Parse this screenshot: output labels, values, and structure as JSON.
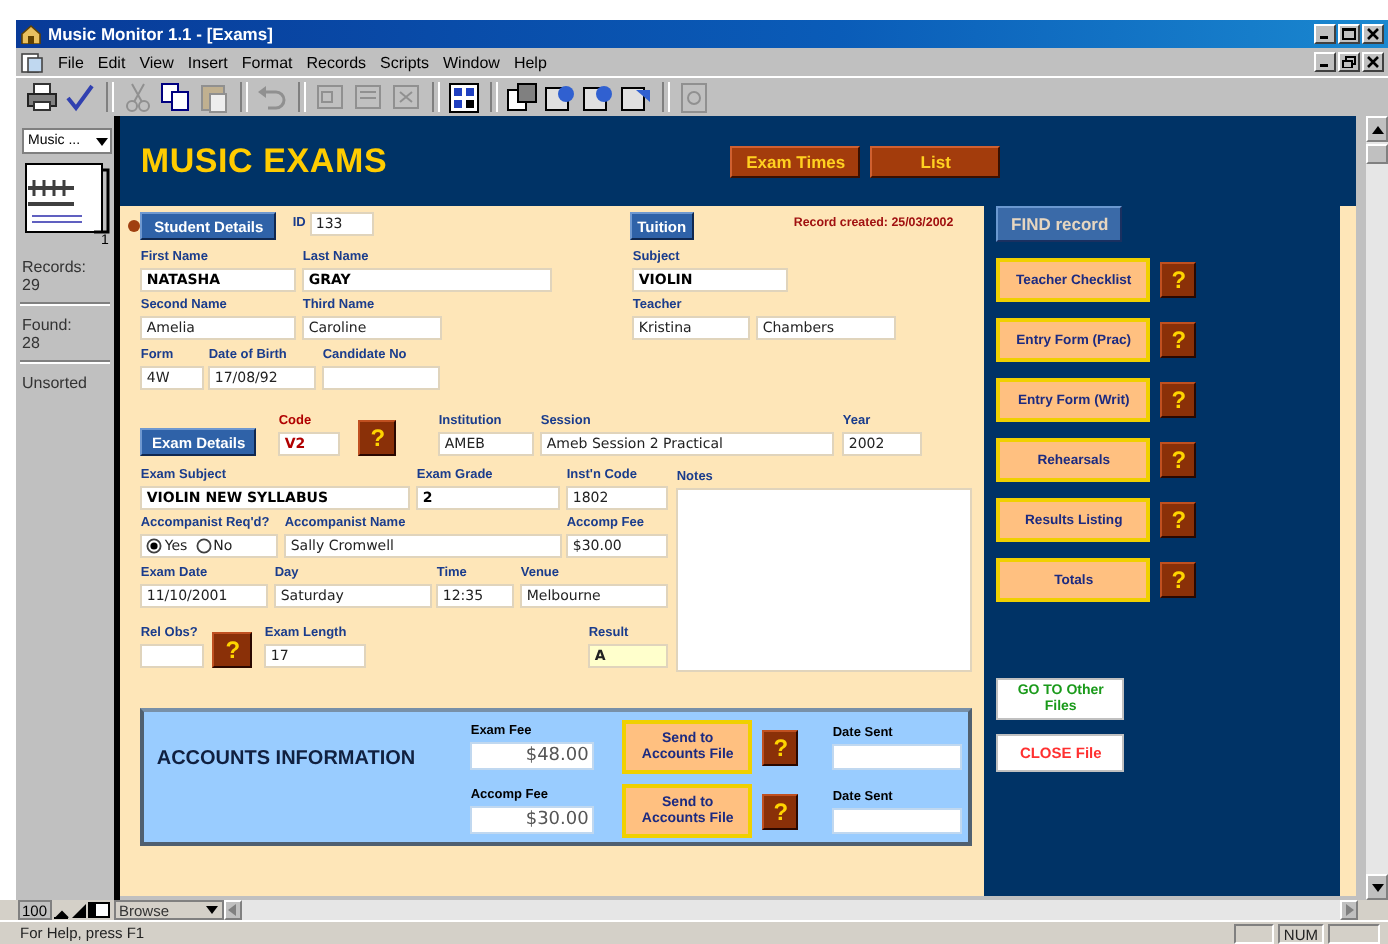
{
  "window": {
    "title": "Music Monitor 1.1 - [Exams]"
  },
  "menu": [
    "File",
    "Edit",
    "View",
    "Insert",
    "Format",
    "Records",
    "Scripts",
    "Window",
    "Help"
  ],
  "status_panel": {
    "layout_menu": "Music ...",
    "record": "1",
    "records_label": "Records:",
    "records": "29",
    "found_label": "Found:",
    "found": "28",
    "sort_state": "Unsorted"
  },
  "header": {
    "title": "MUSIC EXAMS",
    "buttons": [
      "Exam Times",
      "List"
    ]
  },
  "form": {
    "record_created": "Record created: 25/03/2002",
    "rows": [
      [
        {
          "kind": "section",
          "label": "Student Details"
        },
        {
          "kind": "inline",
          "label": "ID",
          "value": "133"
        },
        {
          "kind": "section",
          "label": "Tuition"
        }
      ],
      [
        {
          "kind": "field",
          "label": "First Name",
          "value": "NATASHA"
        },
        {
          "kind": "field",
          "label": "Last Name",
          "value": "GRAY"
        },
        {
          "kind": "field",
          "label": "Subject",
          "value": "VIOLIN"
        }
      ],
      [
        {
          "kind": "field",
          "label": "Second Name",
          "value": "Amelia"
        },
        {
          "kind": "field",
          "label": "Third Name",
          "value": "Caroline"
        },
        {
          "kind": "pair",
          "label": "Teacher",
          "values": [
            "Kristina",
            "Chambers"
          ]
        }
      ],
      [
        {
          "kind": "field",
          "label": "Form",
          "value": "4W"
        },
        {
          "kind": "field",
          "label": "Date of Birth",
          "value": "17/08/92"
        },
        {
          "kind": "field",
          "label": "Candidate No"
        }
      ],
      [
        {
          "kind": "section",
          "label": "Exam Details"
        },
        {
          "kind": "field",
          "label": "Code",
          "value": "V2"
        },
        {
          "kind": "help",
          "label": "?"
        },
        {
          "kind": "field",
          "label": "Institution",
          "value": "AMEB"
        },
        {
          "kind": "field",
          "label": "Session",
          "value": "Ameb Session 2 Practical"
        },
        {
          "kind": "field",
          "label": "Year",
          "value": "2002"
        }
      ],
      [
        {
          "kind": "field",
          "label": "Exam Subject",
          "value": "VIOLIN NEW SYLLABUS"
        },
        {
          "kind": "field",
          "label": "Exam Grade",
          "value": "2"
        },
        {
          "kind": "field",
          "label": "Inst'n Code",
          "value": "1802"
        }
      ],
      [
        {
          "kind": "radio",
          "label": "Accompanist Req'd?",
          "options": [
            {
              "label": "Yes",
              "selected": true
            },
            {
              "label": "No",
              "selected": false
            }
          ]
        },
        {
          "kind": "field",
          "label": "Accompanist Name",
          "value": "Sally Cromwell"
        },
        {
          "kind": "field",
          "label": "Accomp Fee",
          "value": "$30.00"
        }
      ],
      [
        {
          "kind": "field",
          "label": "Exam Date",
          "value": "11/10/2001"
        },
        {
          "kind": "field",
          "label": "Day",
          "value": "Saturday"
        },
        {
          "kind": "field",
          "label": "Time",
          "value": "12:35"
        },
        {
          "kind": "field",
          "label": "Venue",
          "value": "Melbourne"
        }
      ],
      [
        {
          "kind": "field",
          "label": "Rel Obs?"
        },
        {
          "kind": "help",
          "label": "?"
        },
        {
          "kind": "field",
          "label": "Exam Length",
          "value": "17"
        },
        {
          "kind": "field",
          "label": "Result",
          "value": "A"
        }
      ]
    ],
    "notes": {
      "label": "Notes"
    }
  },
  "accounts": {
    "title": "ACCOUNTS INFORMATION",
    "rows": [
      {
        "fee_label": "Exam Fee",
        "fee": "$48.00",
        "button": "Send to Accounts File",
        "help": "?",
        "date_label": "Date Sent"
      },
      {
        "fee_label": "Accomp Fee",
        "fee": "$30.00",
        "button": "Send to Accounts File",
        "help": "?",
        "date_label": "Date Sent"
      }
    ]
  },
  "side_panel": {
    "find_button": "FIND record",
    "reports": [
      {
        "label": "Teacher Checklist",
        "help": "?"
      },
      {
        "label": "Entry Form (Prac)",
        "help": "?"
      },
      {
        "label": "Entry Form (Writ)",
        "help": "?"
      },
      {
        "label": "Rehearsals",
        "help": "?"
      },
      {
        "label": "Results Listing",
        "help": "?"
      },
      {
        "label": "Totals",
        "help": "?"
      }
    ],
    "go_to_button": "GO TO Other Files",
    "close_button": "CLOSE File"
  },
  "bottom_bar": {
    "zoom": "100",
    "mode": "Browse"
  },
  "status_bar": {
    "help_text": "For Help, press F1",
    "num_lock": "NUM"
  }
}
